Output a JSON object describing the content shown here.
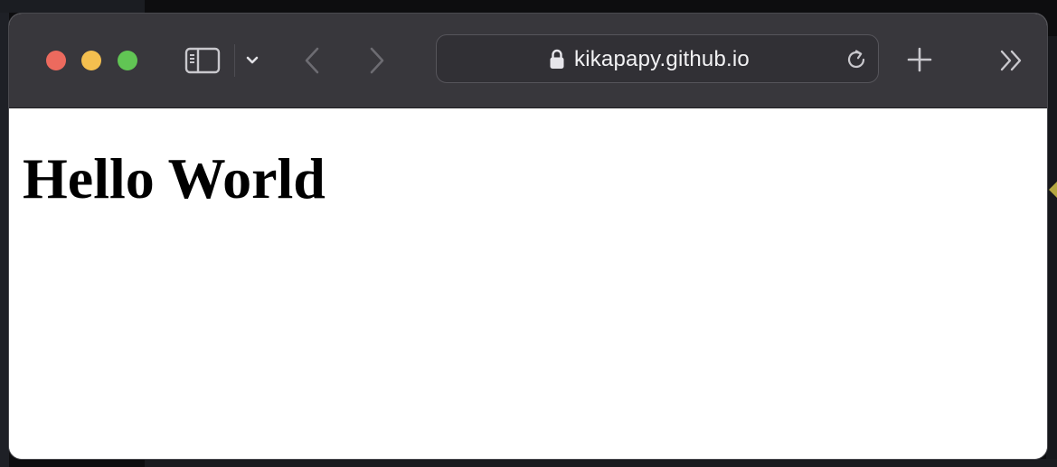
{
  "browser": {
    "address_bar": {
      "url": "kikapapy.github.io"
    }
  },
  "page": {
    "heading": "Hello World"
  },
  "colors": {
    "toolbar": "#38373c",
    "close_light": "#ec6a5e",
    "minimize_light": "#f4bf4f",
    "maximize_light": "#61c554",
    "page_background": "#ffffff",
    "heading_text": "#000000"
  },
  "icons": {
    "sidebar": "sidebar-icon",
    "tab_group_menu": "chevron-down-icon",
    "back": "chevron-left-icon",
    "forward": "chevron-right-icon",
    "secure": "lock-icon",
    "reload": "reload-icon",
    "new_tab": "plus-icon",
    "overflow": "double-chevron-right-icon"
  }
}
